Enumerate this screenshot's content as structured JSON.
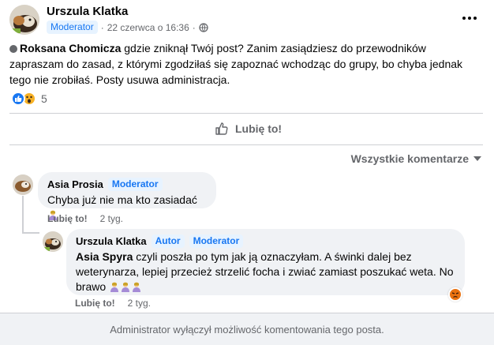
{
  "post": {
    "author": "Urszula Klatka",
    "role_badge": "Moderator",
    "separator": "·",
    "date": "22 czerwca o 16:36",
    "separator2": "·",
    "mention": "Roksana Chomicza",
    "text": " gdzie zniknął Twój post? Zanim zasiądziesz do przewodników zapraszam do zasad, z którymi zgodziłaś się zapoznać wchodząc do grupy, bo chyba jednak tego nie zrobiłaś. Posty usuwa administracja.",
    "reaction_count": "5",
    "like_action": "Lubię to!"
  },
  "comments_sort": "Wszystkie komentarze",
  "comments": [
    {
      "author": "Asia Prosia",
      "badges": [
        "Moderator"
      ],
      "text": "Chyba już nie ma kto zasiadać",
      "like_label": "Lubię to!",
      "time": "2 tyg."
    },
    {
      "author": "Urszula Klatka",
      "badges": [
        "Autor",
        "Moderator"
      ],
      "mention": "Asia Spyra",
      "text": " czyli poszła po tym jak ją oznaczyłam. A świnki dalej bez weterynarza, lepiej przecież strzelić focha i zwiać zamiast poszukać weta. No brawo",
      "like_label": "Lubię to!",
      "time": "2 tyg."
    }
  ],
  "footer_notice": "Administrator wyłączył możliwość komentowania tego posta.",
  "colors": {
    "accent": "#1877f2",
    "badge_bg": "#e7f3ff",
    "bubble_bg": "#f0f2f5",
    "muted_text": "#65676b",
    "wow": "#f7b125",
    "angry": "#e9710f"
  },
  "icons": {
    "more": "more-horizontal-icon",
    "globe": "globe-icon",
    "like_thumb": "thumb-up-icon",
    "sort_arrow": "caret-down-icon",
    "status": "status-dot-icon"
  }
}
